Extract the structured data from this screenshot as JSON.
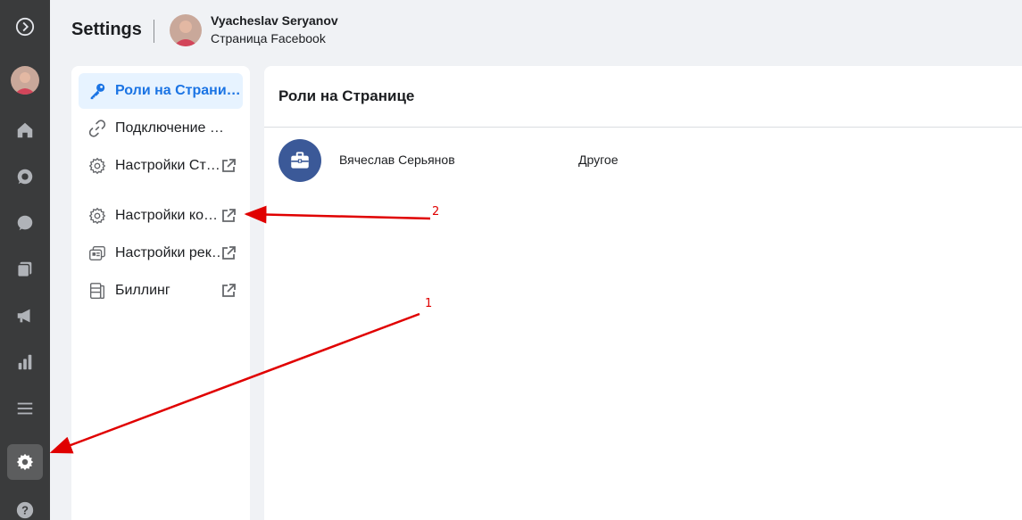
{
  "header": {
    "title": "Settings",
    "account_name": "Vyacheslav Seryanov",
    "account_type": "Страница Facebook"
  },
  "rail": {
    "items": [
      {
        "icon": "logo-icon"
      },
      {
        "icon": "avatar"
      },
      {
        "icon": "home-icon"
      },
      {
        "icon": "whatsapp-icon"
      },
      {
        "icon": "messenger-icon"
      },
      {
        "icon": "pages-icon"
      },
      {
        "icon": "megaphone-icon"
      },
      {
        "icon": "insights-icon"
      },
      {
        "icon": "menu-icon"
      },
      {
        "icon": "gear-icon",
        "active": true
      },
      {
        "icon": "help-icon"
      }
    ]
  },
  "nav": {
    "items": [
      {
        "label": "Роли на Странице",
        "icon": "key-icon",
        "active": true,
        "external": false
      },
      {
        "label": "Подключение аккаунтов",
        "icon": "link-icon",
        "active": false,
        "external": false
      },
      {
        "label": "Настройки Страницы",
        "icon": "gear-icon",
        "active": false,
        "external": true
      },
      {
        "label": "Настройки компании",
        "icon": "gear-icon",
        "active": false,
        "external": true
      },
      {
        "label": "Настройки рекламы",
        "icon": "ads-icon",
        "active": false,
        "external": true
      },
      {
        "label": "Биллинг",
        "icon": "billing-icon",
        "active": false,
        "external": true
      }
    ]
  },
  "main": {
    "title": "Роли на Странице",
    "roles": [
      {
        "name": "Вячеслав Серьянов",
        "role": "Другое"
      }
    ]
  },
  "annotations": {
    "label_1": "1",
    "label_2": "2",
    "color": "#e00000"
  },
  "colors": {
    "accent": "#1b74e4",
    "rail_bg": "#3a3b3c",
    "active_bg": "#e7f3ff"
  }
}
